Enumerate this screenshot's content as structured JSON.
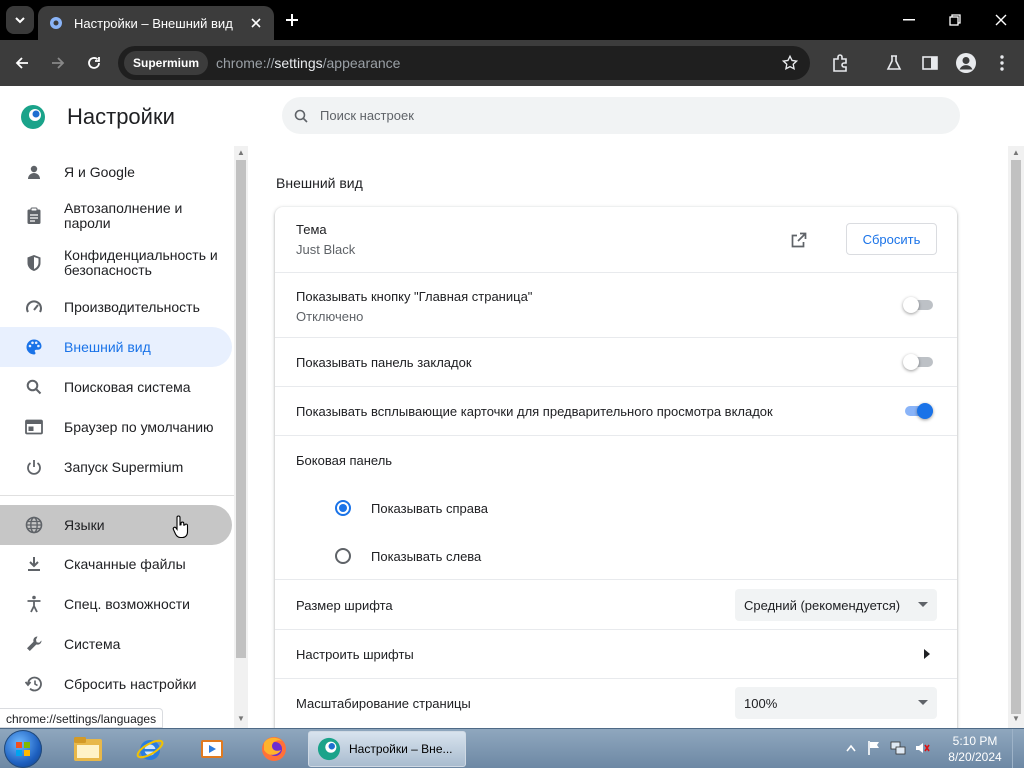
{
  "browser": {
    "tab_title": "Настройки – Внешний вид",
    "chip": "Supermium",
    "url_prefix": "chrome://",
    "url_host": "settings",
    "url_path": "/appearance",
    "accent": "#1a73e8"
  },
  "settings": {
    "title": "Настройки",
    "search_placeholder": "Поиск настроек",
    "sidebar": {
      "items": [
        {
          "label": "Я и Google",
          "icon": "person-icon"
        },
        {
          "label": "Автозаполнение и пароли",
          "icon": "clipboard-icon"
        },
        {
          "label": "Конфиденциальность и безопасность",
          "icon": "shield-icon"
        },
        {
          "label": "Производительность",
          "icon": "speedometer-icon"
        },
        {
          "label": "Внешний вид",
          "icon": "palette-icon",
          "active": true
        },
        {
          "label": "Поисковая система",
          "icon": "search-icon"
        },
        {
          "label": "Браузер по умолчанию",
          "icon": "browser-icon"
        },
        {
          "label": "Запуск Supermium",
          "icon": "power-icon"
        },
        {
          "label": "Языки",
          "icon": "globe-icon",
          "hovered": true
        },
        {
          "label": "Скачанные файлы",
          "icon": "download-icon"
        },
        {
          "label": "Спец. возможности",
          "icon": "accessibility-icon"
        },
        {
          "label": "Система",
          "icon": "wrench-icon"
        },
        {
          "label": "Сбросить настройки",
          "icon": "history-icon"
        }
      ]
    },
    "section_title": "Внешний вид",
    "theme": {
      "label": "Тема",
      "value": "Just Black",
      "reset_label": "Сбросить"
    },
    "home_button": {
      "label": "Показывать кнопку \"Главная страница\"",
      "sub": "Отключено",
      "enabled": false
    },
    "bookmarks_bar": {
      "label": "Показывать панель закладок",
      "enabled": false
    },
    "hover_cards": {
      "label": "Показывать всплывающие карточки для предварительного просмотра вкладок",
      "enabled": true
    },
    "side_panel": {
      "label": "Боковая панель",
      "options": [
        "Показывать справа",
        "Показывать слева"
      ],
      "selected": 0
    },
    "font_size": {
      "label": "Размер шрифта",
      "value": "Средний (рекомендуется)"
    },
    "customize_fonts": {
      "label": "Настроить шрифты"
    },
    "zoom": {
      "label": "Масштабирование страницы",
      "value": "100%"
    }
  },
  "status_url": "chrome://settings/languages",
  "taskbar": {
    "task_label": "Настройки – Вне...",
    "time": "5:10 PM",
    "date": "8/20/2024"
  }
}
